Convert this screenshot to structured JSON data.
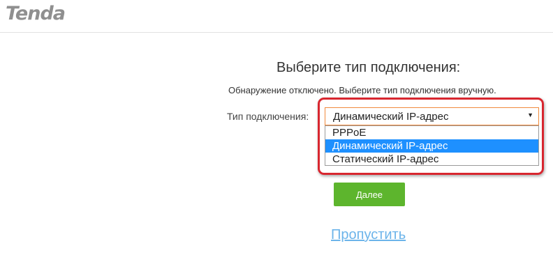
{
  "header": {
    "logo_text": "Tenda"
  },
  "main": {
    "title": "Выберите тип подключения:",
    "notice": "Обнаружение отключено. Выберите тип подключения вручную.",
    "connection_label": "Тип подключения:",
    "connection_select": {
      "value": "Динамический IP-адрес",
      "options": [
        {
          "label": "PPPoE",
          "selected": false
        },
        {
          "label": "Динамический IP-адрес",
          "selected": true
        },
        {
          "label": "Статический IP-адрес",
          "selected": false
        }
      ]
    },
    "next_label": "Далее",
    "skip_label": "Пропустить"
  },
  "icons": {
    "dropdown_arrow": "chevron-down-icon"
  },
  "colors": {
    "logo": "#8f8f8f",
    "highlight_frame": "#d8262f",
    "select_border": "#f08a3c",
    "option_selected_bg": "#1e90ff",
    "next_button": "#5db52d",
    "skip_link": "#6cb4ea"
  }
}
